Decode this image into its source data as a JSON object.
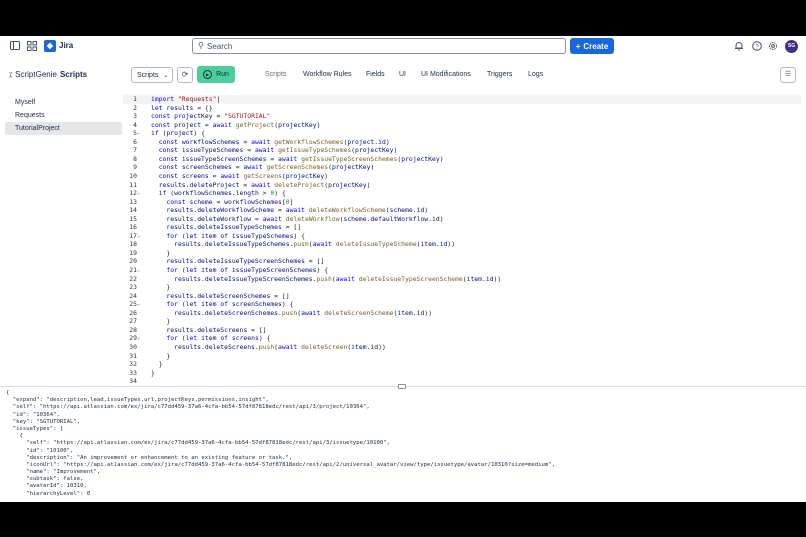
{
  "topbar": {
    "app_name": "Jira",
    "search_placeholder": "Search",
    "create_label": "Create",
    "avatar_initials": "SG"
  },
  "appbar": {
    "title_prefix": "ScriptGenie",
    "title": "Scripts",
    "scripts_dropdown": "Scripts",
    "run_label": "Run",
    "tabs": [
      {
        "label": "Scripts"
      },
      {
        "label": "Workflow Rules"
      },
      {
        "label": "Fields"
      },
      {
        "label": "UI"
      },
      {
        "label": "UI Modifications"
      },
      {
        "label": "Triggers"
      },
      {
        "label": "Logs"
      }
    ]
  },
  "sidebar": {
    "items": [
      {
        "label": "Myself"
      },
      {
        "label": "Requests"
      },
      {
        "label": "TutorialProject"
      }
    ]
  },
  "editor": {
    "lines": [
      "import \"Requests\"",
      "let results = {}",
      "const projectKey = \"SGTUTORIAL\"",
      "const project = await getProject(projectKey)",
      "if (project) {",
      "  const workflowSchemes = await getWorkflowSchemes(project.id)",
      "  const issueTypeSchemes = await getIssueTypeSchemes(projectKey)",
      "  const issueTypeScreenSchemes = await getIssueTypeScreenSchemes(projectKey)",
      "  const screenSchemes = await getScreenSchemes(projectKey)",
      "  const screens = await getScreens(projectKey)",
      "  results.deleteProject = await deleteProject(projectKey)",
      "  if (workflowSchemes.length > 0) {",
      "    const scheme = workflowSchemes[0]",
      "    results.deleteWorkflowScheme = await deleteWorkflowScheme(scheme.id)",
      "    results.deleteWorkflow = await deleteWorkflow(scheme.defaultWorkflow.id)",
      "    results.deleteIssueTypeSchemes = []",
      "    for (let item of issueTypeSchemes) {",
      "      results.deleteIssueTypeSchemes.push(await deleteIssueTypeScheme(item.id))",
      "    }",
      "    results.deleteIssueTypeScreenSchemes = []",
      "    for (let item of issueTypeScreenSchemes) {",
      "      results.deleteIssueTypeScreenSchemes.push(await deleteIssueTypeScreenScheme(item.id))",
      "    }",
      "    results.deleteScreenSchemes = []",
      "    for (let item of screenSchemes) {",
      "      results.deleteScreenSchemes.push(await deleteScreenScheme(item.id))",
      "    }",
      "    results.deleteScreens = []",
      "    for (let item of screens) {",
      "      results.deleteScreens.push(await deleteScreen(item.id))",
      "    }",
      "  }",
      "}",
      ""
    ],
    "fold_lines": [
      5,
      12,
      17,
      21,
      25,
      29
    ],
    "current_line": 1
  },
  "output": {
    "lines": [
      "{",
      "  \"expand\": \"description,lead,issueTypes,url,projectKeys,permissions,insight\",",
      "  \"self\": \"https://api.atlassian.com/ex/jira/c77dd459-37a6-4cfa-bb54-57df87818edc/rest/api/3/project/10364\",",
      "  \"id\": \"10364\",",
      "  \"key\": \"SGTUTORIAL\",",
      "  \"issueTypes\": [",
      "    {",
      "      \"self\": \"https://api.atlassian.com/ex/jira/c77dd459-37a6-4cfa-bb54-57df87818edc/rest/api/3/issuetype/10100\",",
      "      \"id\": \"10100\",",
      "      \"description\": \"An improvement or enhancement to an existing feature or task.\",",
      "      \"iconUrl\": \"https://api.atlassian.com/ex/jira/c77dd459-37a6-4cfa-bb54-57df87818edc/rest/api/2/universal_avatar/view/type/issuetype/avatar/10310?size=medium\",",
      "      \"name\": \"Improvement\",",
      "      \"subtask\": false,",
      "      \"avatarId\": 10310,",
      "      \"hierarchyLevel\": 0"
    ]
  }
}
